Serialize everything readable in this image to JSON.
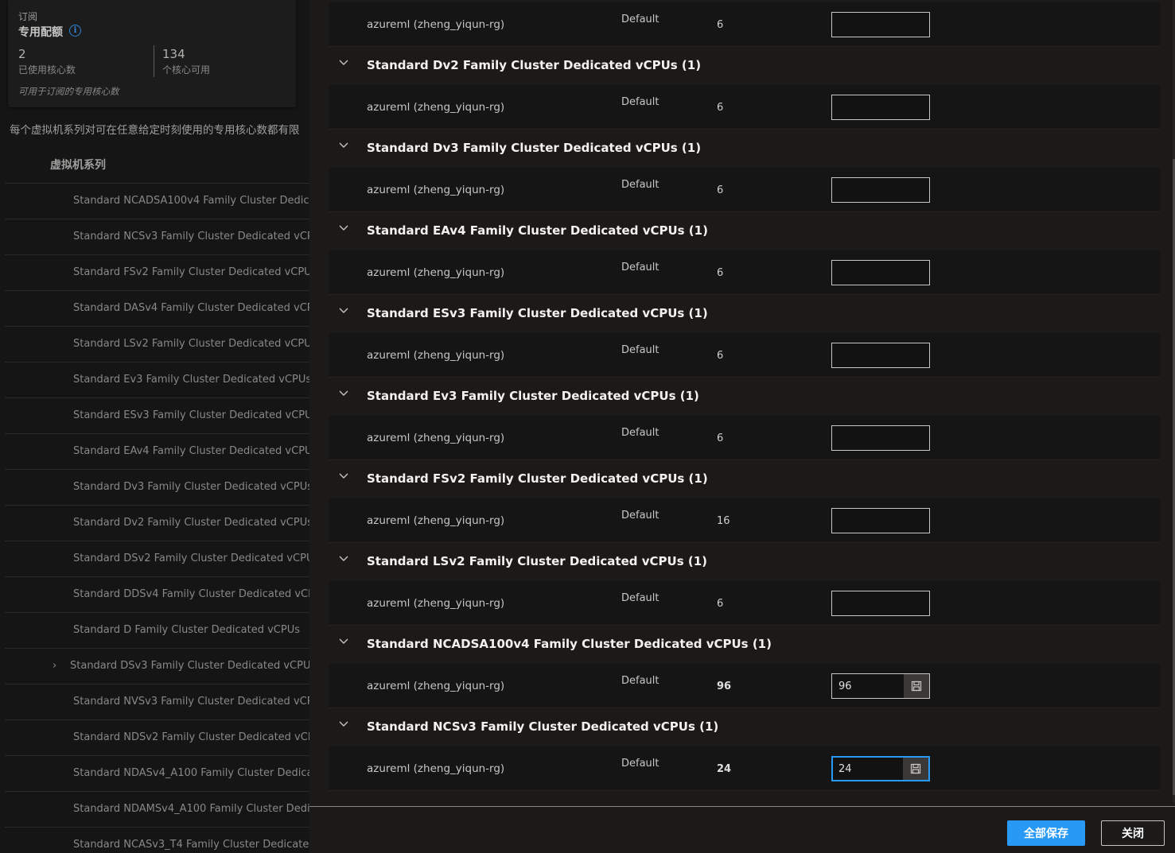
{
  "background_page": {
    "subscription_label": "订阅",
    "quota_title": "专用配额",
    "info_icon": "i",
    "used_cores_value": "2",
    "used_cores_label": "已使用核心数",
    "available_cores_value": "134",
    "available_cores_label": "个核心可用",
    "quota_footnote": "可用于订阅的专用核心数",
    "info_text": "每个虚拟机系列对可在任意给定时刻使用的专用核心数都有限",
    "vm_header": "虚拟机系列",
    "vm_rows": [
      {
        "label": "Standard NCADSA100v4 Family Cluster Dedicated vCPUs"
      },
      {
        "label": "Standard NCSv3 Family Cluster Dedicated vCPUs"
      },
      {
        "label": "Standard FSv2 Family Cluster Dedicated vCPUs"
      },
      {
        "label": "Standard DASv4 Family Cluster Dedicated vCPUs"
      },
      {
        "label": "Standard LSv2 Family Cluster Dedicated vCPUs"
      },
      {
        "label": "Standard Ev3 Family Cluster Dedicated vCPUs"
      },
      {
        "label": "Standard ESv3 Family Cluster Dedicated vCPUs"
      },
      {
        "label": "Standard EAv4 Family Cluster Dedicated vCPUs"
      },
      {
        "label": "Standard Dv3 Family Cluster Dedicated vCPUs"
      },
      {
        "label": "Standard Dv2 Family Cluster Dedicated vCPUs"
      },
      {
        "label": "Standard DSv2 Family Cluster Dedicated vCPUs"
      },
      {
        "label": "Standard DDSv4 Family Cluster Dedicated vCPUs"
      },
      {
        "label": "Standard D Family Cluster Dedicated vCPUs"
      },
      {
        "label": "Standard DSv3 Family Cluster Dedicated vCPUs",
        "chevron": "›"
      },
      {
        "label": "Standard NVSv3 Family Cluster Dedicated vCPUs"
      },
      {
        "label": "Standard NDSv2 Family Cluster Dedicated vCPUs"
      },
      {
        "label": "Standard NDASv4_A100 Family Cluster Dedicated vCPUs"
      },
      {
        "label": "Standard NDAMSv4_A100 Family Cluster Dedicated vCPUs"
      },
      {
        "label": "Standard NCASv3_T4 Family Cluster Dedicated vCPUs"
      }
    ]
  },
  "dialog": {
    "first_row": {
      "resource": "azureml (zheng_yiqun-rg)",
      "default_label": "Default",
      "limit": "6",
      "new_limit": ""
    },
    "groups": [
      {
        "title": "Standard Dv2 Family Cluster Dedicated vCPUs (1)",
        "row": {
          "resource": "azureml (zheng_yiqun-rg)",
          "default_label": "Default",
          "limit": "6",
          "new_limit": ""
        }
      },
      {
        "title": "Standard Dv3 Family Cluster Dedicated vCPUs (1)",
        "row": {
          "resource": "azureml (zheng_yiqun-rg)",
          "default_label": "Default",
          "limit": "6",
          "new_limit": ""
        }
      },
      {
        "title": "Standard EAv4 Family Cluster Dedicated vCPUs (1)",
        "row": {
          "resource": "azureml (zheng_yiqun-rg)",
          "default_label": "Default",
          "limit": "6",
          "new_limit": ""
        }
      },
      {
        "title": "Standard ESv3 Family Cluster Dedicated vCPUs (1)",
        "row": {
          "resource": "azureml (zheng_yiqun-rg)",
          "default_label": "Default",
          "limit": "6",
          "new_limit": ""
        }
      },
      {
        "title": "Standard Ev3 Family Cluster Dedicated vCPUs (1)",
        "row": {
          "resource": "azureml (zheng_yiqun-rg)",
          "default_label": "Default",
          "limit": "6",
          "new_limit": ""
        }
      },
      {
        "title": "Standard FSv2 Family Cluster Dedicated vCPUs (1)",
        "row": {
          "resource": "azureml (zheng_yiqun-rg)",
          "default_label": "Default",
          "limit": "16",
          "new_limit": ""
        }
      },
      {
        "title": "Standard LSv2 Family Cluster Dedicated vCPUs (1)",
        "row": {
          "resource": "azureml (zheng_yiqun-rg)",
          "default_label": "Default",
          "limit": "6",
          "new_limit": ""
        }
      },
      {
        "title": "Standard NCADSA100v4 Family Cluster Dedicated vCPUs (1)",
        "row": {
          "resource": "azureml (zheng_yiqun-rg)",
          "default_label": "Default",
          "limit": "96",
          "new_limit": "96",
          "save": true
        }
      },
      {
        "title": "Standard NCSv3 Family Cluster Dedicated vCPUs (1)",
        "row": {
          "resource": "azureml (zheng_yiqun-rg)",
          "default_label": "Default",
          "limit": "24",
          "new_limit": "24",
          "save": true,
          "focused": true
        }
      }
    ],
    "save_all_label": "全部保存",
    "close_label": "关闭"
  },
  "colors": {
    "accent": "#2899f5",
    "dialog_bg": "#1b1a19",
    "row_bg": "#151515"
  }
}
